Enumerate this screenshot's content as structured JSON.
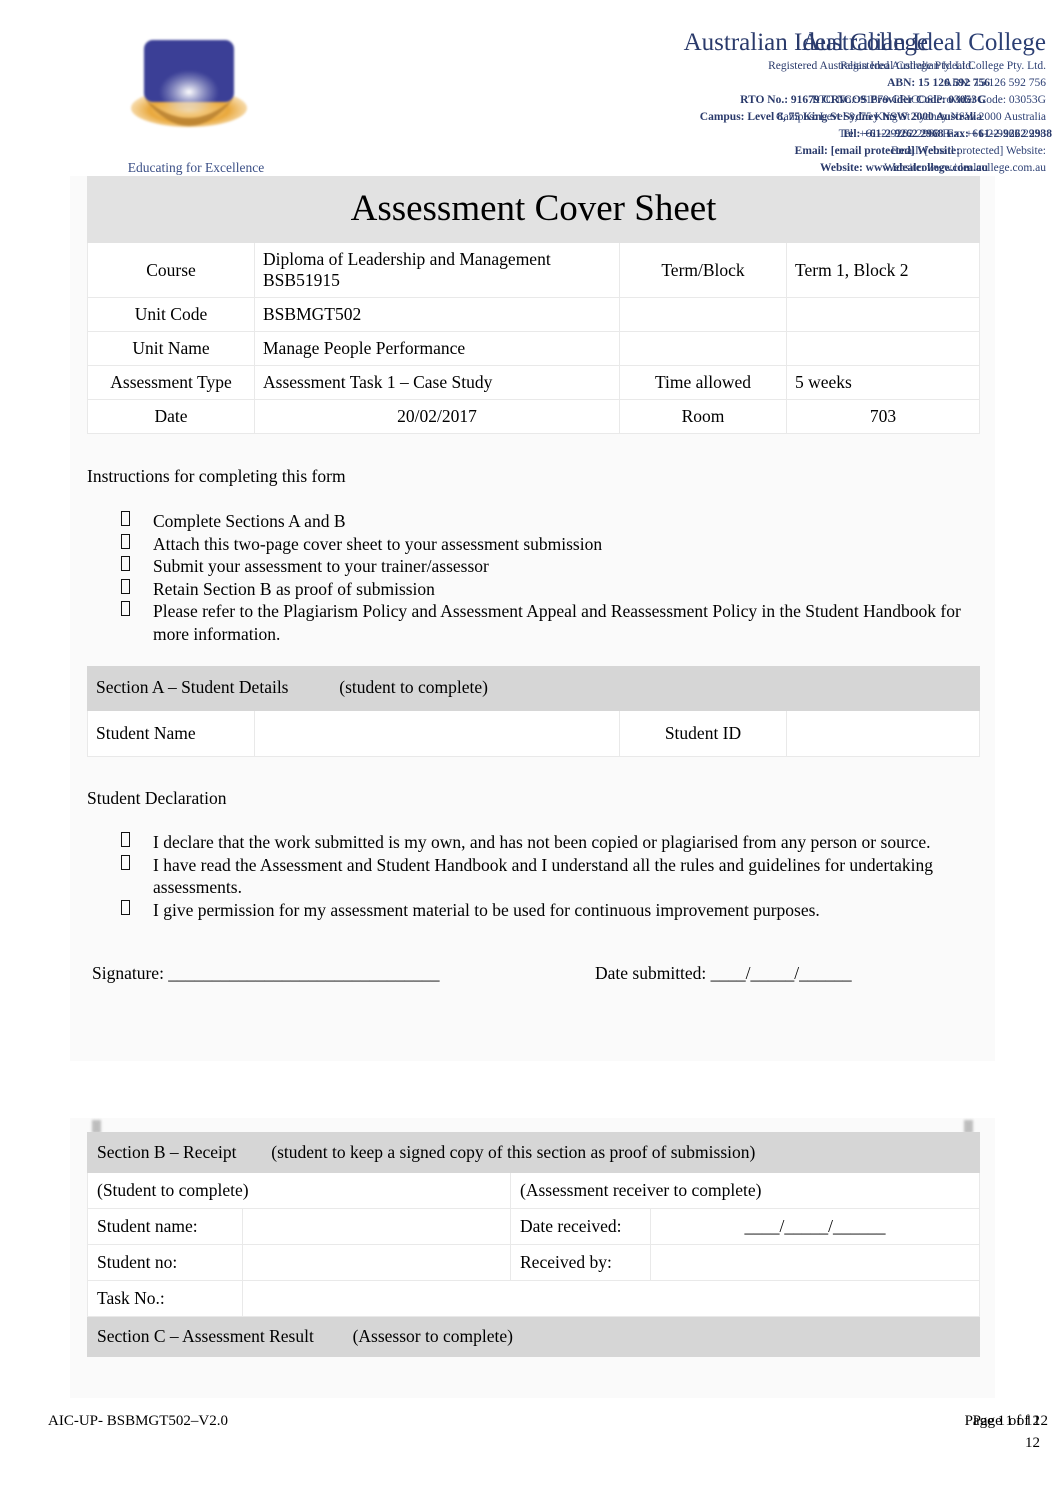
{
  "header": {
    "logo_tagline": "Educating for Excellence",
    "org_name": "Australian Ideal College",
    "lines": [
      "Registered Australian Ideal College Pty. Ltd.",
      "ABN: 15 126 592 756",
      "RTO No.: 91679   CRICOS Provider Code: 03053G",
      "Campus: Level 8, 75 King St Sydney NSW 2000 Australia",
      "Tel: +61-2-9262 2968     Fax: +61-2-9262 2938",
      "Email: [email protected]   Website:",
      "Website: www.idealcollege.com.au"
    ]
  },
  "document": {
    "title": "Assessment Cover Sheet"
  },
  "details": {
    "course_label": "Course",
    "course_value": "Diploma of Leadership and Management BSB51915",
    "term_label": "Term/Block",
    "term_value": "Term 1, Block 2",
    "unit_code_label": "Unit Code",
    "unit_code_value": "BSBMGT502",
    "unit_name_label": "Unit Name",
    "unit_name_value": "Manage People Performance",
    "assessment_type_label": "Assessment Type",
    "assessment_type_value": "Assessment Task 1 – Case Study",
    "time_allowed_label": "Time allowed",
    "time_allowed_value": "5 weeks",
    "date_label": "Date",
    "date_value": "20/02/2017",
    "room_label": "Room",
    "room_value": "703"
  },
  "instructions": {
    "heading": "Instructions for completing this form",
    "items": [
      "Complete Sections A and B",
      "Attach this two-page cover sheet to your assessment submission",
      "Submit your assessment to your trainer/assessor",
      "Retain Section B as proof of submission",
      "Please refer to the Plagiarism Policy and Assessment Appeal and Reassessment Policy in the Student Handbook for more information."
    ]
  },
  "section_a": {
    "heading": "Section A – Student Details",
    "note": "(student to complete)",
    "student_name_label": "Student Name",
    "student_name_value": "",
    "student_id_label": "Student ID",
    "student_id_value": "",
    "declaration_heading": "Student Declaration",
    "declaration_items": [
      "I declare that the work submitted is my own, and has not been copied or plagiarised from any person or source.",
      "I have read the Assessment and Student Handbook and I understand all the rules and guidelines for undertaking assessments.",
      "I give permission for my assessment material to be used for continuous improvement purposes."
    ],
    "signature_label": "Signature: _______________________________",
    "date_submitted_label": "Date submitted:  ____/_____/______"
  },
  "section_b": {
    "heading": "Section B – Receipt",
    "note": "(student to keep a signed copy of this section as proof of submission)",
    "col_left_note": "(Student to complete)",
    "col_right_note": "(Assessment receiver to complete)",
    "student_name_label": "Student name:",
    "student_name_value": "",
    "date_received_label": "Date received:",
    "date_received_value": "____/_____/______",
    "student_no_label": "Student no:",
    "student_no_value": "",
    "received_by_label": "Received by:",
    "received_by_value": "",
    "task_no_label": "Task No.:",
    "task_no_value": ""
  },
  "section_c": {
    "heading": "Section C – Assessment Result",
    "note": "(Assessor to complete)"
  },
  "footer": {
    "left": "AIC-UP- BSBMGT502–V2.0",
    "right_line1": "Page 1 of 12",
    "right_line2": "12"
  },
  "colors": {
    "brand_blue": "#2c3f73",
    "header_gray": "#d6d6d6",
    "title_gray": "#e2e2e2",
    "border_gray": "#e9e9e9"
  }
}
